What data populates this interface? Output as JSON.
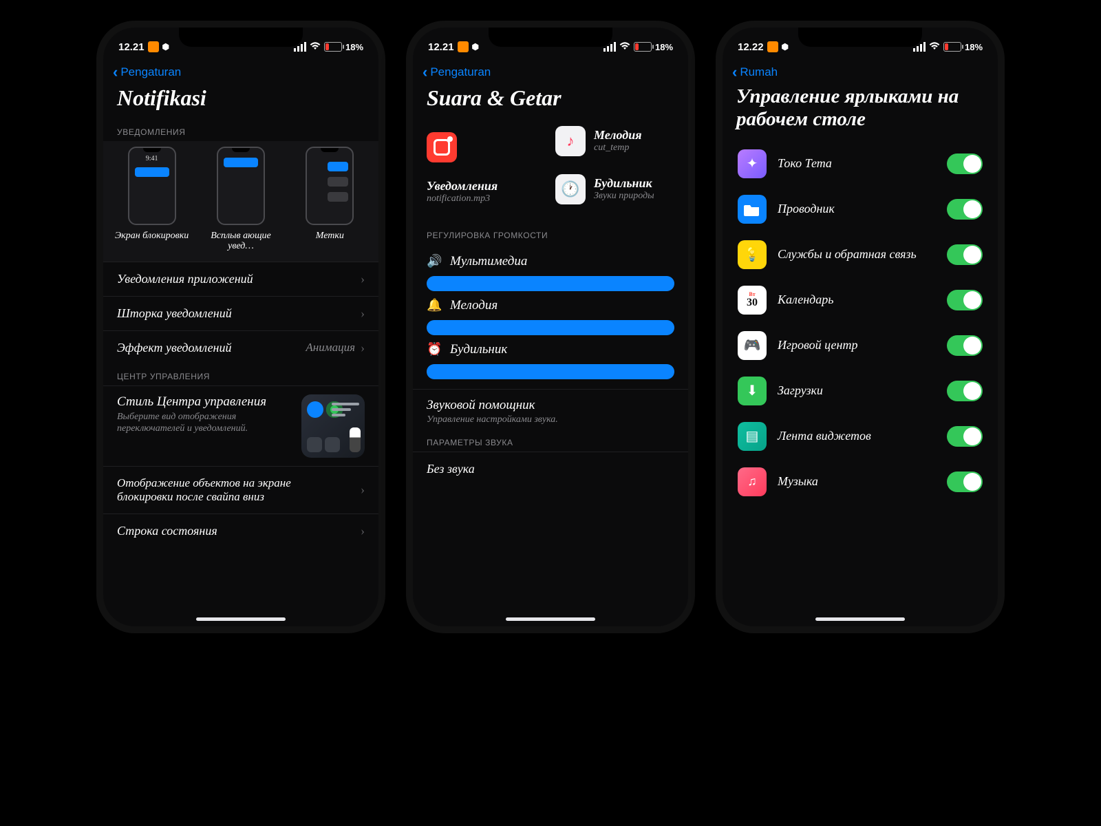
{
  "status": {
    "time_a": "12.21",
    "time_b": "12.22",
    "battery_pct": "18",
    "battery_suffix": "%"
  },
  "phone1": {
    "back": "Pengaturan",
    "title": "Notifikasi",
    "section_notifications": "УВЕДОМЛЕНИЯ",
    "tiles": {
      "lock": "Экран блокировки",
      "popup": "Всплыв ающие увед…",
      "badges": "Метки",
      "clock": "9:41"
    },
    "rows": {
      "app_notif": "Уведомления приложений",
      "shade": "Шторка уведомлений",
      "effect": "Эффект уведомлений",
      "effect_value": "Анимация"
    },
    "section_cc": "ЦЕНТР УПРАВЛЕНИЯ",
    "cc": {
      "title": "Стиль Центра управления",
      "sub": "Выберите вид отображения переключателей и уведомлений."
    },
    "swipe": "Отображение объектов на экране блокировки после свайпа вниз",
    "statusbar": "Строка состояния"
  },
  "phone2": {
    "back": "Pengaturan",
    "title": "Suara & Getar",
    "cards": {
      "notif_title": "Уведомления",
      "notif_sub": "notification.mp3",
      "melody_title": "Мелодия",
      "melody_sub": "cut_temp",
      "alarm_title": "Будильник",
      "alarm_sub": "Звуки природы"
    },
    "section_volume": "РЕГУЛИРОВКА ГРОМКОСТИ",
    "sliders": {
      "media": "Мультимедиа",
      "melody": "Мелодия",
      "alarm": "Будильник"
    },
    "helper": {
      "title": "Звуковой помощник",
      "sub": "Управление настройками звука."
    },
    "section_params": "ПАРАМЕТРЫ ЗВУКА",
    "silent": "Без звука"
  },
  "phone3": {
    "back": "Rumah",
    "title": "Управление ярлыками на рабочем столе",
    "apps": {
      "theme": "Токо Тета",
      "files": "Проводник",
      "feedback": "Службы и обратная связь",
      "calendar": "Календарь",
      "cal_top": "Вт",
      "cal_day": "30",
      "games": "Игровой центр",
      "downloads": "Загрузки",
      "widgets": "Лента виджетов",
      "music": "Музыка"
    }
  }
}
